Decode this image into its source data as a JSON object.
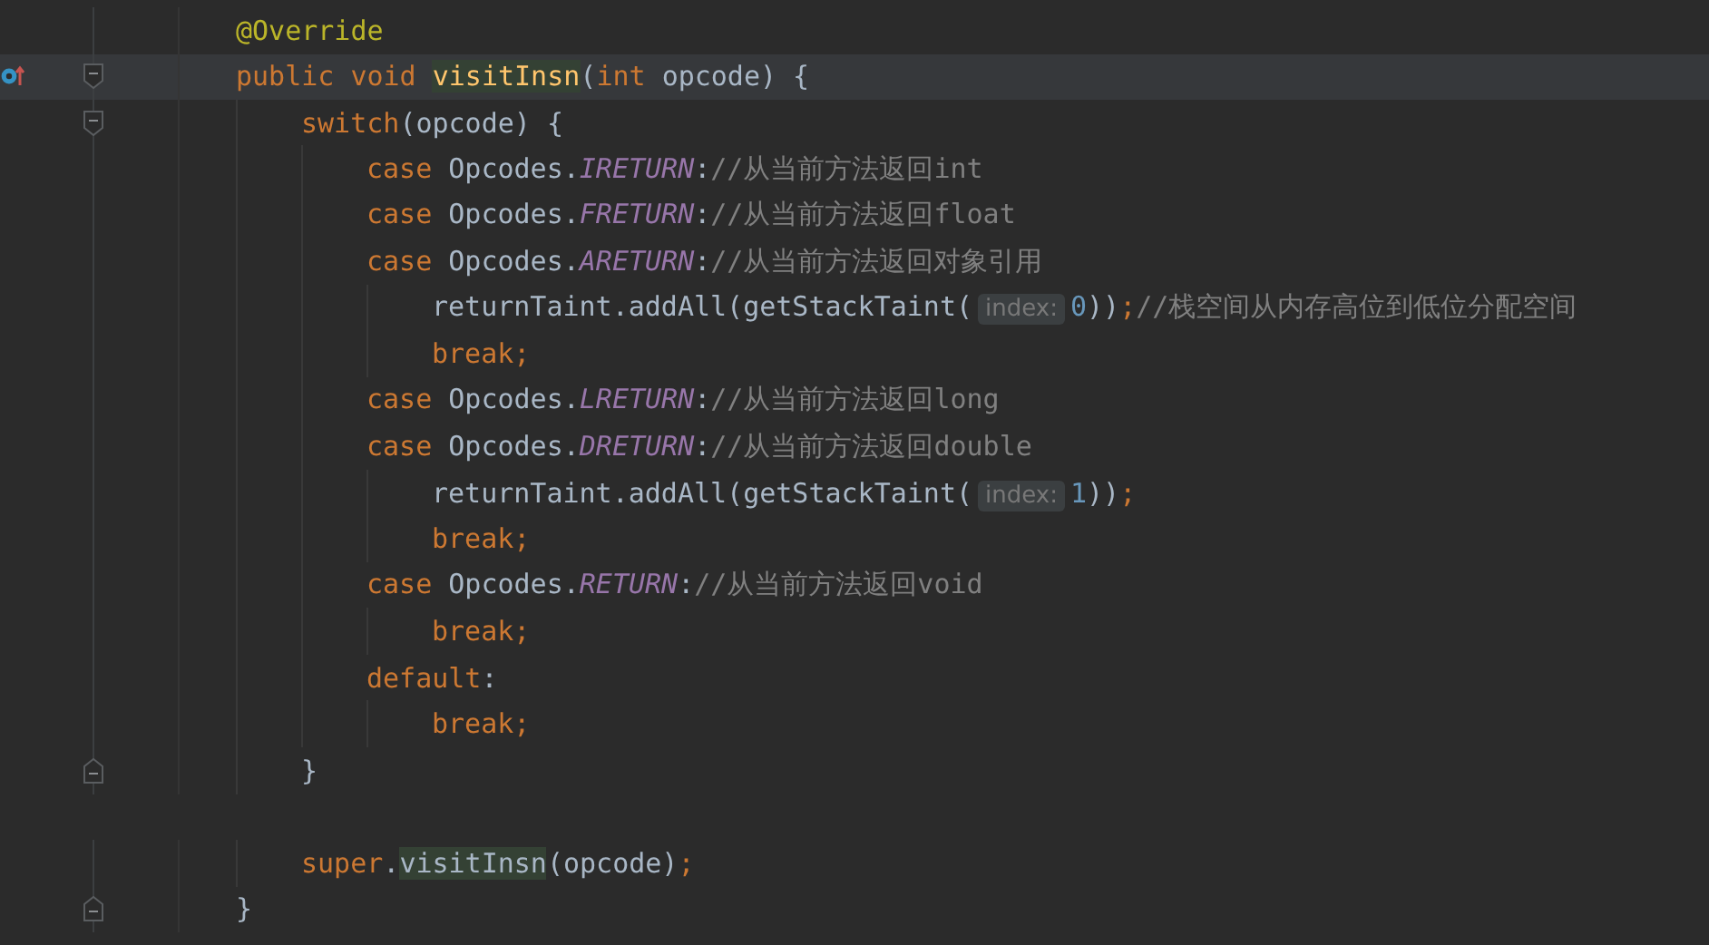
{
  "code": [
    {
      "tokens": [
        {
          "kind": "annotation",
          "text": "@Override"
        }
      ]
    },
    {
      "current": true,
      "override_marker": true,
      "fold_start": true,
      "tokens": [
        {
          "kind": "keyword",
          "text": "public void "
        },
        {
          "kind": "method_decl",
          "text": "visitInsn"
        },
        {
          "kind": "plain",
          "text": "("
        },
        {
          "kind": "keyword",
          "text": "int "
        },
        {
          "kind": "plain",
          "text": "opcode) {"
        }
      ],
      "children": [
        {
          "fold_start": true,
          "tokens": [
            {
              "kind": "keyword",
              "text": "switch"
            },
            {
              "kind": "plain",
              "text": "(opcode) {"
            }
          ],
          "children": [
            {
              "tokens": [
                {
                  "kind": "keyword",
                  "text": "case "
                },
                {
                  "kind": "plain",
                  "text": "Opcodes."
                },
                {
                  "kind": "field",
                  "text": "IRETURN"
                },
                {
                  "kind": "plain",
                  "text": ":"
                },
                {
                  "kind": "comment",
                  "text": "//从当前方法返回int"
                }
              ]
            },
            {
              "tokens": [
                {
                  "kind": "keyword",
                  "text": "case "
                },
                {
                  "kind": "plain",
                  "text": "Opcodes."
                },
                {
                  "kind": "field",
                  "text": "FRETURN"
                },
                {
                  "kind": "plain",
                  "text": ":"
                },
                {
                  "kind": "comment",
                  "text": "//从当前方法返回float"
                }
              ]
            },
            {
              "tokens": [
                {
                  "kind": "keyword",
                  "text": "case "
                },
                {
                  "kind": "plain",
                  "text": "Opcodes."
                },
                {
                  "kind": "field",
                  "text": "ARETURN"
                },
                {
                  "kind": "plain",
                  "text": ":"
                },
                {
                  "kind": "comment",
                  "text": "//从当前方法返回对象引用"
                }
              ],
              "children": [
                {
                  "tokens": [
                    {
                      "kind": "plain",
                      "text": "returnTaint.addAll(getStackTaint("
                    },
                    {
                      "kind": "hint",
                      "text": "index:"
                    },
                    {
                      "kind": "number",
                      "text": "0"
                    },
                    {
                      "kind": "plain",
                      "text": "))"
                    },
                    {
                      "kind": "keyword",
                      "text": ";"
                    },
                    {
                      "kind": "comment",
                      "text": "//栈空间从内存高位到低位分配空间"
                    }
                  ]
                },
                {
                  "tokens": [
                    {
                      "kind": "keyword",
                      "text": "break;"
                    }
                  ]
                }
              ]
            },
            {
              "tokens": [
                {
                  "kind": "keyword",
                  "text": "case "
                },
                {
                  "kind": "plain",
                  "text": "Opcodes."
                },
                {
                  "kind": "field",
                  "text": "LRETURN"
                },
                {
                  "kind": "plain",
                  "text": ":"
                },
                {
                  "kind": "comment",
                  "text": "//从当前方法返回long"
                }
              ]
            },
            {
              "tokens": [
                {
                  "kind": "keyword",
                  "text": "case "
                },
                {
                  "kind": "plain",
                  "text": "Opcodes."
                },
                {
                  "kind": "field",
                  "text": "DRETURN"
                },
                {
                  "kind": "plain",
                  "text": ":"
                },
                {
                  "kind": "comment",
                  "text": "//从当前方法返回double"
                }
              ],
              "children": [
                {
                  "tokens": [
                    {
                      "kind": "plain",
                      "text": "returnTaint.addAll(getStackTaint("
                    },
                    {
                      "kind": "hint",
                      "text": "index:"
                    },
                    {
                      "kind": "number",
                      "text": "1"
                    },
                    {
                      "kind": "plain",
                      "text": "))"
                    },
                    {
                      "kind": "keyword",
                      "text": ";"
                    }
                  ]
                },
                {
                  "tokens": [
                    {
                      "kind": "keyword",
                      "text": "break;"
                    }
                  ]
                }
              ]
            },
            {
              "tokens": [
                {
                  "kind": "keyword",
                  "text": "case "
                },
                {
                  "kind": "plain",
                  "text": "Opcodes."
                },
                {
                  "kind": "field",
                  "text": "RETURN"
                },
                {
                  "kind": "plain",
                  "text": ":"
                },
                {
                  "kind": "comment",
                  "text": "//从当前方法返回void"
                }
              ],
              "children": [
                {
                  "tokens": [
                    {
                      "kind": "keyword",
                      "text": "break;"
                    }
                  ]
                }
              ]
            },
            {
              "tokens": [
                {
                  "kind": "keyword",
                  "text": "default"
                },
                {
                  "kind": "plain",
                  "text": ":"
                }
              ],
              "children": [
                {
                  "tokens": [
                    {
                      "kind": "keyword",
                      "text": "break;"
                    }
                  ]
                }
              ]
            }
          ]
        },
        {
          "fold_end": true,
          "tokens": [
            {
              "kind": "plain",
              "text": "}"
            }
          ]
        },
        {
          "gap_before": true,
          "tokens": [
            {
              "kind": "keyword",
              "text": "super"
            },
            {
              "kind": "plain",
              "text": "."
            },
            {
              "kind": "method_usage",
              "text": "visitInsn"
            },
            {
              "kind": "plain",
              "text": "(opcode)"
            },
            {
              "kind": "keyword",
              "text": ";"
            }
          ]
        }
      ]
    },
    {
      "fold_end": true,
      "tokens": [
        {
          "kind": "plain",
          "text": "}"
        }
      ]
    }
  ]
}
